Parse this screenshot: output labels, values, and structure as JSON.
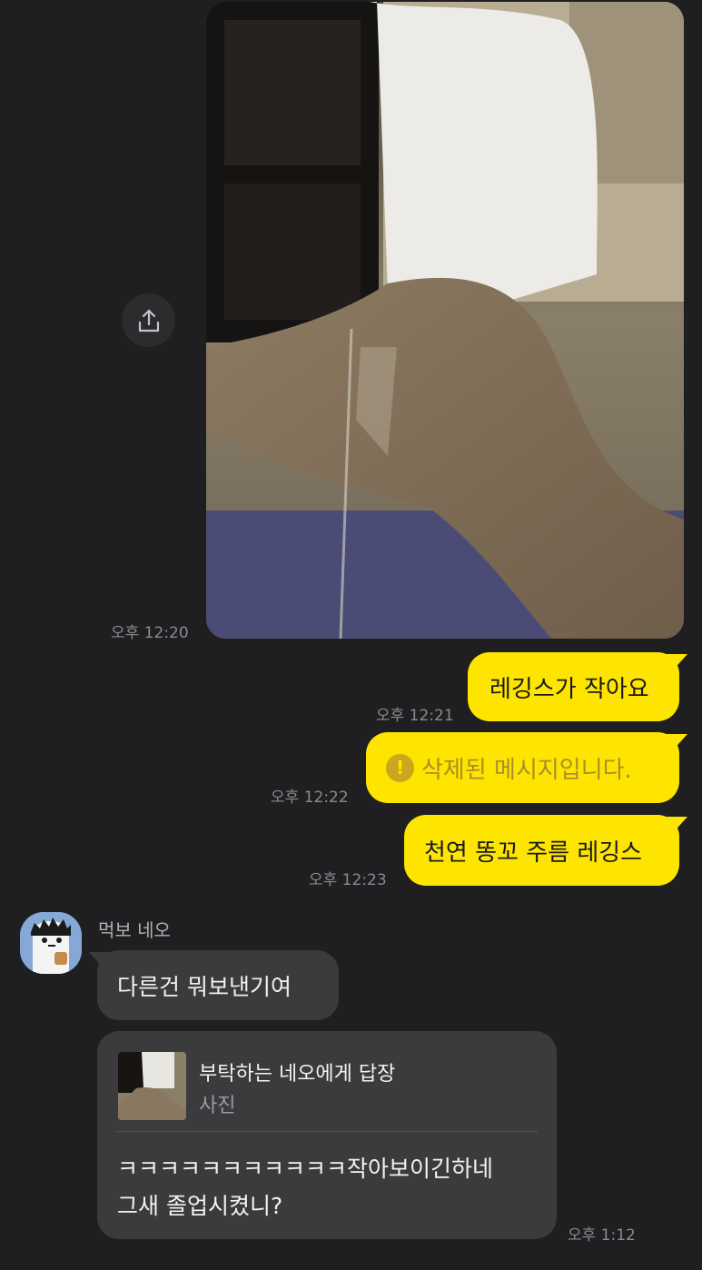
{
  "colors": {
    "background": "#1f1f21",
    "my_bubble": "#fee500",
    "other_bubble": "#3b3b3e",
    "timestamp": "#8b8b8f"
  },
  "photo_message": {
    "time": "오후 12:20",
    "share_icon": "share-icon"
  },
  "my_messages": [
    {
      "text": "레깅스가 작아요",
      "time": "오후 12:21"
    },
    {
      "text": "삭제된 메시지입니다.",
      "time": "오후 12:22",
      "deleted": true,
      "icon": "exclamation-icon"
    },
    {
      "text": "천연 똥꼬 주름 레깅스",
      "time": "오후 12:23"
    }
  ],
  "other": {
    "name": "먹보 네오",
    "message": "다른건 뭐보낸기여",
    "reply": {
      "title": "부탁하는 네오에게 답장",
      "subtitle": "사진",
      "lines": [
        "ㅋㅋㅋㅋㅋㅋㅋㅋㅋㅋㅋ작아보이긴하네",
        "그새 졸업시켰니?"
      ],
      "time": "오후 1:12"
    }
  }
}
